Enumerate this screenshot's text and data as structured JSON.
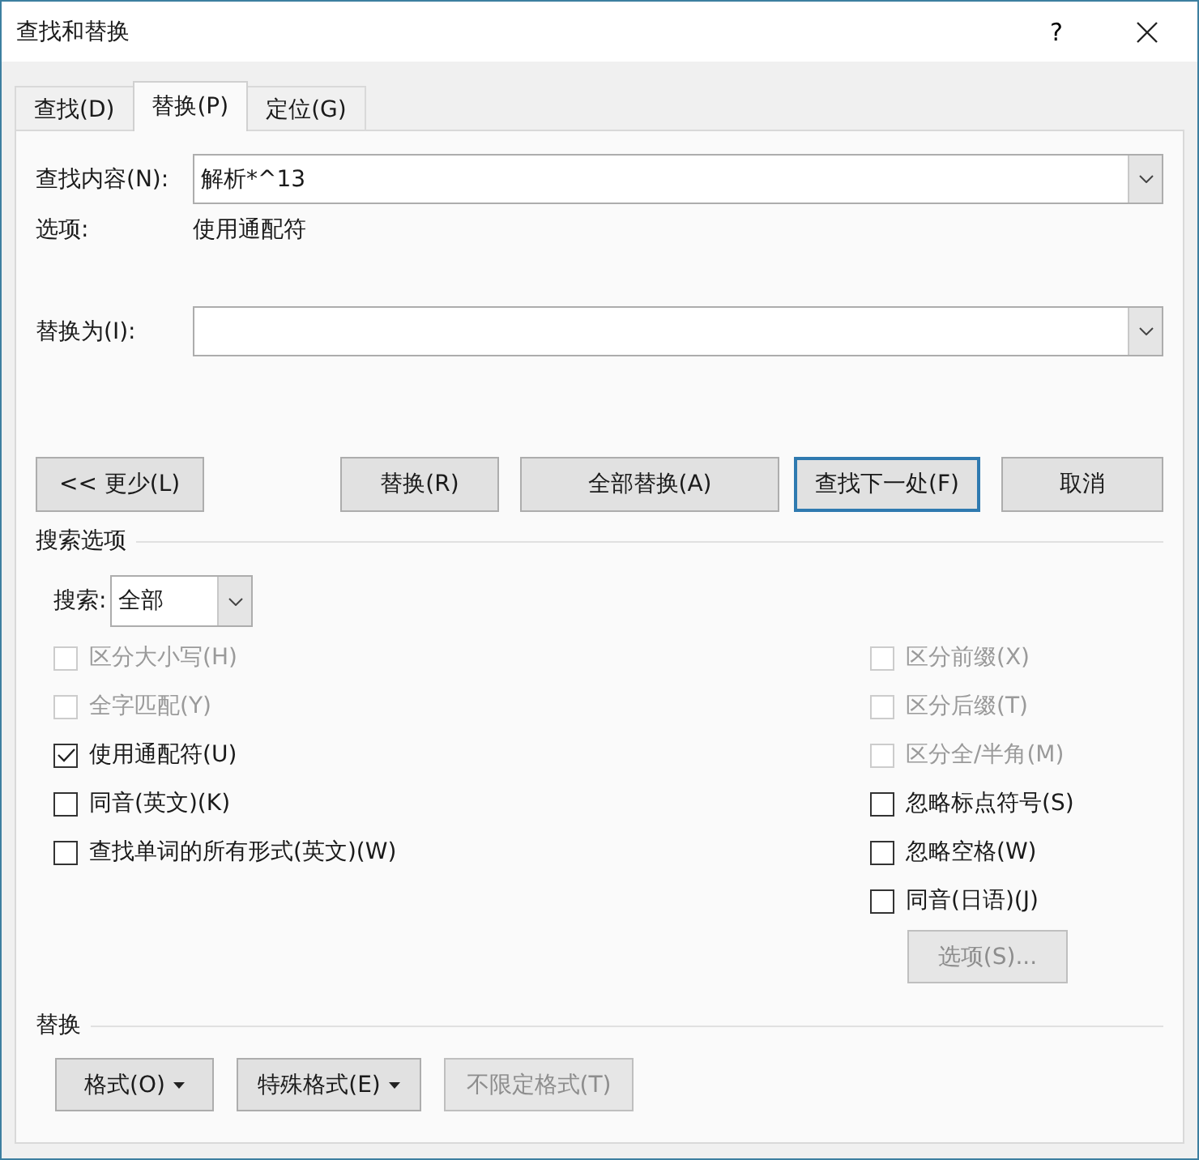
{
  "window": {
    "title": "查找和替换",
    "help": "?"
  },
  "tabs": [
    {
      "label": "查找(D)",
      "selected": false
    },
    {
      "label": "替换(P)",
      "selected": true
    },
    {
      "label": "定位(G)",
      "selected": false
    }
  ],
  "find": {
    "label": "查找内容(N):",
    "value": "解析*^13"
  },
  "options_line": {
    "label": "选项:",
    "value": "使用通配符"
  },
  "replace": {
    "label": "替换为(I):"
  },
  "buttons": [
    {
      "label": "<< 更少(L)",
      "kind": "normal"
    },
    {
      "label": "替换(R)",
      "kind": "normal"
    },
    {
      "label": "全部替换(A)",
      "kind": "normal"
    },
    {
      "label": "查找下一处(F)",
      "kind": "default"
    },
    {
      "label": "取消",
      "kind": "normal"
    }
  ],
  "search_options": {
    "title": "搜索选项",
    "search_label": "搜索:",
    "search_value": "全部",
    "left_checkboxes": [
      {
        "label": "区分大小写(H)",
        "checked": false,
        "disabled": true
      },
      {
        "label": "全字匹配(Y)",
        "checked": false,
        "disabled": true
      },
      {
        "label": "使用通配符(U)",
        "checked": true,
        "disabled": false
      },
      {
        "label": "同音(英文)(K)",
        "checked": false,
        "disabled": false
      },
      {
        "label": "查找单词的所有形式(英文)(W)",
        "checked": false,
        "disabled": false
      }
    ],
    "right_checkboxes": [
      {
        "label": "区分前缀(X)",
        "checked": false,
        "disabled": true
      },
      {
        "label": "区分后缀(T)",
        "checked": false,
        "disabled": true
      },
      {
        "label": "区分全/半角(M)",
        "checked": false,
        "disabled": true
      },
      {
        "label": "忽略标点符号(S)",
        "checked": false,
        "disabled": false
      },
      {
        "label": "忽略空格(W)",
        "checked": false,
        "disabled": false
      },
      {
        "label": "同音(日语)(J)",
        "checked": false,
        "disabled": false
      }
    ],
    "options_button": {
      "label": "选项(S)...",
      "disabled": true
    }
  },
  "replace_section": {
    "title": "替换",
    "buttons": [
      {
        "label": "格式(O)",
        "dropdown": true,
        "disabled": false
      },
      {
        "label": "特殊格式(E)",
        "dropdown": true,
        "disabled": false
      },
      {
        "label": "不限定格式(T)",
        "dropdown": false,
        "disabled": true
      }
    ]
  }
}
